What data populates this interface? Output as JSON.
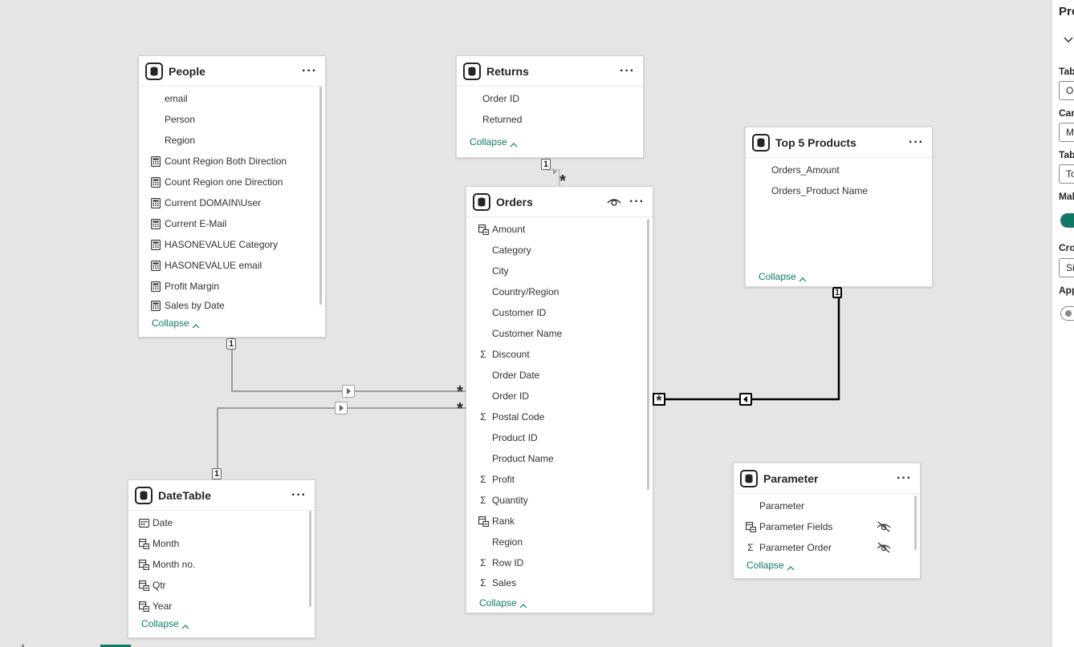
{
  "tables": {
    "people": {
      "title": "People",
      "more": "···",
      "fields": [
        "email",
        "Person",
        "Region",
        "Count Region Both Direction",
        "Count Region one Direction",
        "Current DOMAIN\\User",
        "Current E-Mail",
        "HASONEVALUE Category",
        "HASONEVALUE email",
        "Profit Margin",
        "Sales by Date"
      ],
      "collapse": "Collapse"
    },
    "returns": {
      "title": "Returns",
      "more": "···",
      "fields": [
        "Order ID",
        "Returned"
      ],
      "collapse": "Collapse"
    },
    "top5": {
      "title": "Top 5 Products",
      "more": "···",
      "fields": [
        "Orders_Amount",
        "Orders_Product Name"
      ],
      "collapse": "Collapse"
    },
    "orders": {
      "title": "Orders",
      "more": "···",
      "fields": [
        "Amount",
        "Category",
        "City",
        "Country/Region",
        "Customer ID",
        "Customer Name",
        "Discount",
        "Order Date",
        "Order ID",
        "Postal Code",
        "Product ID",
        "Product Name",
        "Profit",
        "Quantity",
        "Rank",
        "Region",
        "Row ID",
        "Sales"
      ],
      "collapse": "Collapse"
    },
    "datetable": {
      "title": "DateTable",
      "more": "···",
      "fields": [
        "Date",
        "Month",
        "Month no.",
        "Qtr",
        "Year"
      ],
      "collapse": "Collapse"
    },
    "parameter": {
      "title": "Parameter",
      "more": "···",
      "fields": [
        "Parameter",
        "Parameter Fields",
        "Parameter Order"
      ],
      "collapse": "Collapse"
    }
  },
  "relationships": {
    "one": "1",
    "many": "*"
  },
  "properties_panel": {
    "title": "Pro",
    "labels": [
      "Tab",
      "Card",
      "Tab",
      "Mak",
      "Cro",
      "App"
    ],
    "inputs": [
      "Or",
      "M",
      "To",
      "Si"
    ]
  },
  "icons": {
    "table": "table-database-icon",
    "measure": "calculator-icon",
    "sum": "sigma-icon",
    "hierarchy": "hierarchy-icon",
    "date": "calendar-icon",
    "hidden": "eye-hidden-icon",
    "visible": "eye-icon"
  },
  "colors": {
    "accent": "#117865",
    "collapse_link": "#0e7a6a",
    "canvas": "#e6e5e4"
  }
}
